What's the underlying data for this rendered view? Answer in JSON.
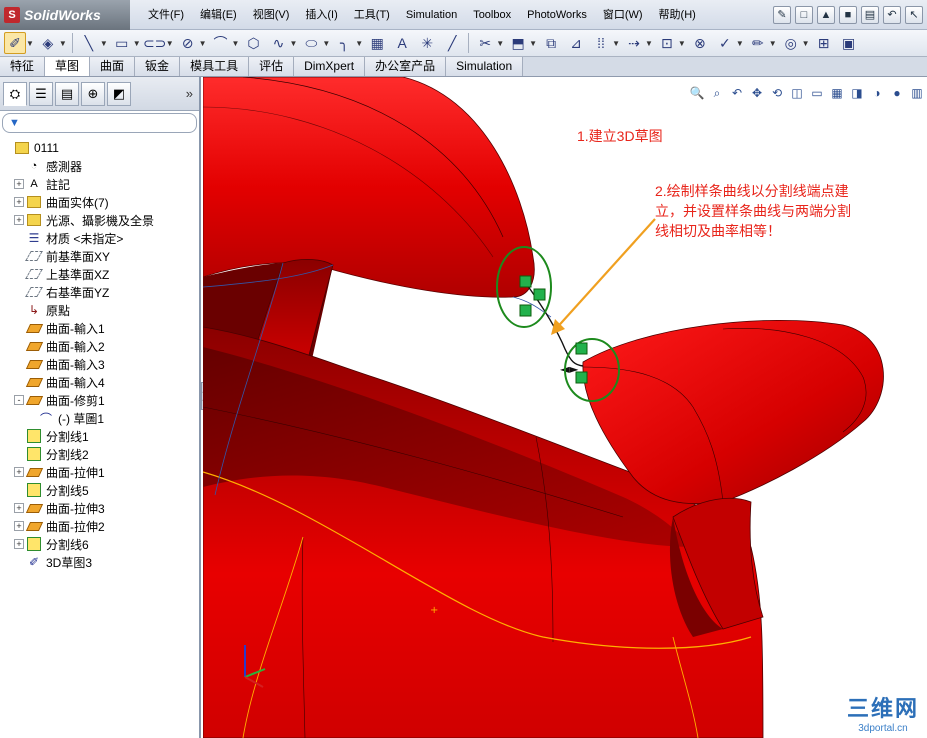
{
  "app": {
    "logo_text": "SolidWorks",
    "logo_mark": "S"
  },
  "menu": [
    "文件(F)",
    "编辑(E)",
    "视图(V)",
    "插入(I)",
    "工具(T)",
    "Simulation",
    "Toolbox",
    "PhotoWorks",
    "窗口(W)",
    "帮助(H)"
  ],
  "command_tabs": [
    "特征",
    "草图",
    "曲面",
    "钣金",
    "模具工具",
    "评估",
    "DimXpert",
    "办公室产品",
    "Simulation"
  ],
  "active_command_tab": "草图",
  "feature_tree": [
    {
      "label": "0111",
      "icon": "part-icon",
      "indent": 0,
      "exp": ""
    },
    {
      "label": "感測器",
      "icon": "sensor-icon",
      "indent": 1,
      "exp": ""
    },
    {
      "label": "註記",
      "icon": "annotation-icon",
      "indent": 1,
      "exp": "+"
    },
    {
      "label": "曲面实体(7)",
      "icon": "surface-bodies-icon",
      "indent": 1,
      "exp": "+"
    },
    {
      "label": "光源、攝影機及全景",
      "icon": "lights-icon",
      "indent": 1,
      "exp": "+"
    },
    {
      "label": "材质 <未指定>",
      "icon": "material-icon",
      "indent": 1,
      "exp": ""
    },
    {
      "label": "前基準面XY",
      "icon": "plane-icon",
      "indent": 1,
      "exp": ""
    },
    {
      "label": "上基準面XZ",
      "icon": "plane-icon",
      "indent": 1,
      "exp": ""
    },
    {
      "label": "右基準面YZ",
      "icon": "plane-icon",
      "indent": 1,
      "exp": ""
    },
    {
      "label": "原點",
      "icon": "origin-icon",
      "indent": 1,
      "exp": ""
    },
    {
      "label": "曲面-輸入1",
      "icon": "surface-icon",
      "indent": 1,
      "exp": ""
    },
    {
      "label": "曲面-輸入2",
      "icon": "surface-icon",
      "indent": 1,
      "exp": ""
    },
    {
      "label": "曲面-輸入3",
      "icon": "surface-icon",
      "indent": 1,
      "exp": ""
    },
    {
      "label": "曲面-輸入4",
      "icon": "surface-icon",
      "indent": 1,
      "exp": ""
    },
    {
      "label": "曲面-修剪1",
      "icon": "surface-trim-icon",
      "indent": 1,
      "exp": "-"
    },
    {
      "label": "(-) 草圖1",
      "icon": "sketch-icon",
      "indent": 2,
      "exp": ""
    },
    {
      "label": "分割线1",
      "icon": "split-line-icon",
      "indent": 1,
      "exp": ""
    },
    {
      "label": "分割线2",
      "icon": "split-line-icon",
      "indent": 1,
      "exp": ""
    },
    {
      "label": "曲面-拉伸1",
      "icon": "surface-extrude-icon",
      "indent": 1,
      "exp": "+"
    },
    {
      "label": "分割线5",
      "icon": "split-line-icon",
      "indent": 1,
      "exp": ""
    },
    {
      "label": "曲面-拉伸3",
      "icon": "surface-extrude-icon",
      "indent": 1,
      "exp": "+"
    },
    {
      "label": "曲面-拉伸2",
      "icon": "surface-extrude-icon",
      "indent": 1,
      "exp": "+"
    },
    {
      "label": "分割线6",
      "icon": "split-line-icon",
      "indent": 1,
      "exp": "+"
    },
    {
      "label": "3D草图3",
      "icon": "3d-sketch-icon",
      "indent": 1,
      "exp": ""
    }
  ],
  "annotations": {
    "step1": "1.建立3D草图",
    "step2": "2.绘制样条曲线以分割线端点建立，并设置样条曲线与两端分割线相切及曲率相等！"
  },
  "watermark": {
    "logo": "三维网",
    "url": "3dportal.cn"
  },
  "colors": {
    "model_red": "#d80000",
    "dark_red": "#7a0000",
    "annotation": "#e8251b",
    "circle_green": "#1d8a1d",
    "arrow_orange": "#f0a020"
  }
}
